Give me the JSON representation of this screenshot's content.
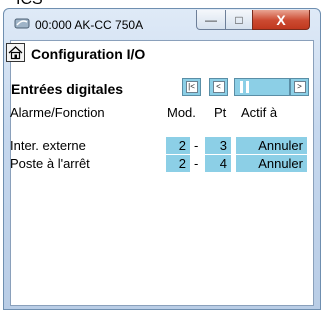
{
  "window": {
    "title": "00:000 AK-CC 750A",
    "close_glyph": "X",
    "min_glyph": "—",
    "max_glyph": "□"
  },
  "header": {
    "title": "Configuration I/O"
  },
  "section": {
    "title": "Entrées digitales"
  },
  "columns": {
    "function": "Alarme/Fonction",
    "module": "Mod.",
    "point": "Pt",
    "active": "Actif à"
  },
  "rows": [
    {
      "label": "Inter. externe",
      "module": "2",
      "separator": "-",
      "point": "3",
      "active": "Annuler"
    },
    {
      "label": "Poste à l'arrêt",
      "module": "2",
      "separator": "-",
      "point": "4",
      "active": "Annuler"
    }
  ],
  "colors": {
    "cell_bg": "#8ccfe6",
    "close_red": "#cc4a31"
  }
}
